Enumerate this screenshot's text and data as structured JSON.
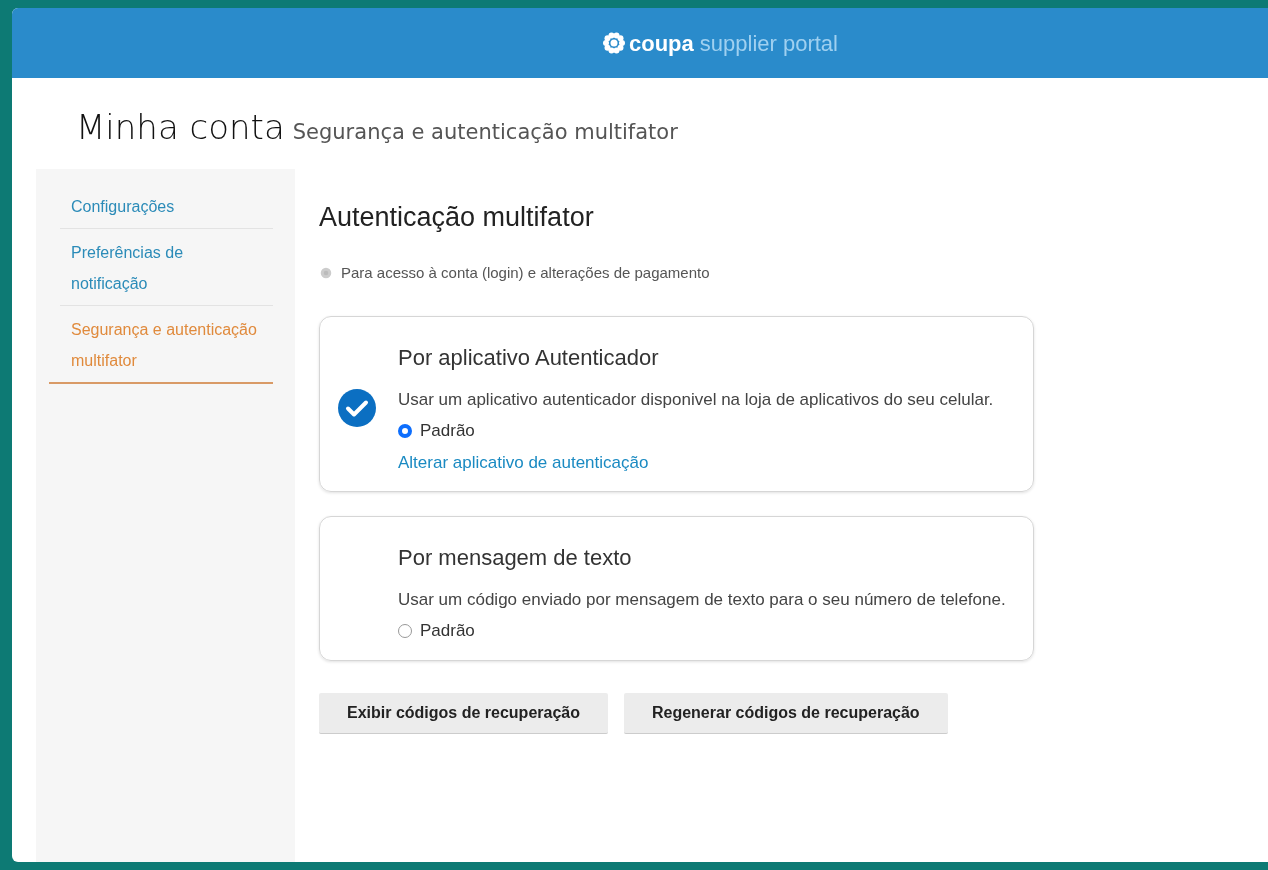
{
  "header": {
    "brand": "coupa",
    "product": "supplier portal"
  },
  "page_title": {
    "title": "Minha conta",
    "subtitle": "Segurança e autenticação multifator"
  },
  "sidebar": {
    "items": [
      {
        "label": "Configurações",
        "selected": false
      },
      {
        "label": "Preferências de notificação",
        "selected": false
      },
      {
        "label": "Segurança e autenticação multifator",
        "selected": true
      }
    ]
  },
  "section": {
    "title": "Autenticação multifator",
    "scope": {
      "label": "Para acesso à conta (login) e alterações de pagamento",
      "checked": true,
      "disabled": true
    },
    "methods": [
      {
        "title": "Por aplicativo Autenticador",
        "description": "Usar um aplicativo autenticador disponivel na loja de aplicativos do seu celular.",
        "selected": true,
        "default_label": "Padrão",
        "default": true,
        "link": "Alterar aplicativo de autenticação"
      },
      {
        "title": "Por mensagem de texto",
        "description": "Usar um código enviado por mensagem de texto para o seu número de telefone.",
        "selected": false,
        "default_label": "Padrão",
        "default": false
      }
    ],
    "buttons": [
      "Exibir códigos de recuperação",
      "Regenerar códigos de recuperação"
    ]
  }
}
